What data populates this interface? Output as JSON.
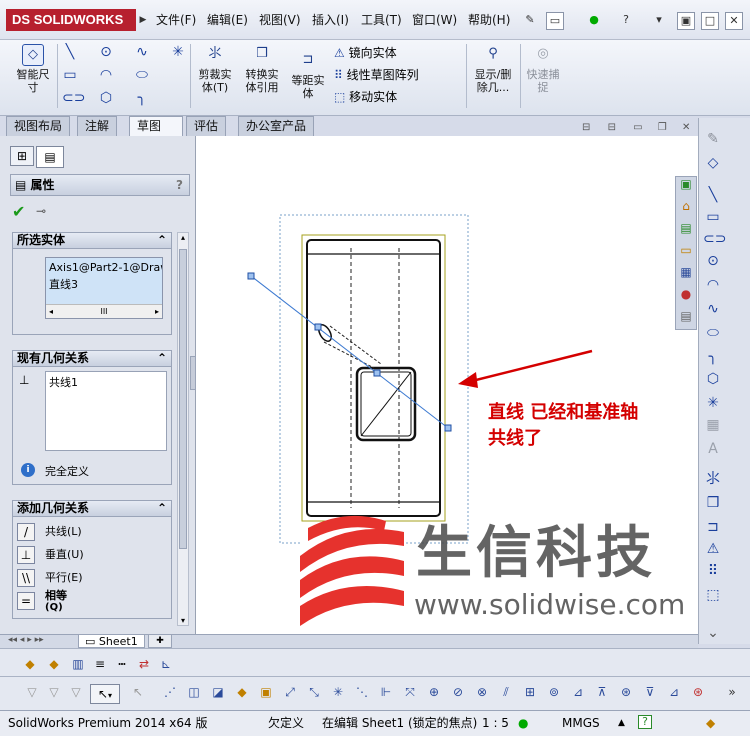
{
  "app": {
    "logo": "SOLIDWORKS",
    "logo_prefix": "DS"
  },
  "menu": [
    "文件(F)",
    "编辑(E)",
    "视图(V)",
    "插入(I)",
    "工具(T)",
    "窗口(W)",
    "帮助(H)"
  ],
  "ribbon": {
    "smart_dim": "智能尺\n寸",
    "trim": "剪裁实\n体(T)",
    "convert": "转换实\n体引用",
    "offset": "等距实\n体",
    "mirror": "镜向实体",
    "linear_pattern": "线性草图阵列",
    "move": "移动实体",
    "show_delete": "显示/删\n除几...",
    "quick_snap": "快速捕\n捉"
  },
  "tabs": [
    "视图布局",
    "注解",
    "草图",
    "评估",
    "办公室产品"
  ],
  "panel": {
    "title": "属性",
    "help": "?",
    "selected_header": "所选实体",
    "selected_items": [
      "Axis1@Part2-1@Draw",
      "直线3"
    ],
    "selected_scroll": "III",
    "existing_header": "现有几何关系",
    "existing_items": [
      "共线1"
    ],
    "status_text": "完全定义",
    "add_header": "添加几何关系",
    "add_items": [
      {
        "label": "共线(L)",
        "icon": "collinear-icon",
        "glyph": "/"
      },
      {
        "label": "垂直(U)",
        "icon": "perpendicular-icon",
        "glyph": "⊥"
      },
      {
        "label": "平行(E)",
        "icon": "parallel-icon",
        "glyph": "\\\\"
      },
      {
        "label": "相等",
        "sub": "(Q)",
        "icon": "equal-icon",
        "glyph": "="
      }
    ],
    "collapse": "⌃"
  },
  "annotation": {
    "line1": "直线  已经和基准轴",
    "line2": "共线了",
    "color": "#d40000"
  },
  "watermark": {
    "cn": "生信科技",
    "url": "www.solidwise.com",
    "color": "#e6322d"
  },
  "sheet_tab": "Sheet1",
  "status": {
    "app": "SolidWorks Premium 2014 x64 版",
    "definition": "欠定义",
    "editing": "在编辑 Sheet1 (锁定的焦点)",
    "scale": "1 : 5",
    "units": "MMGS"
  }
}
